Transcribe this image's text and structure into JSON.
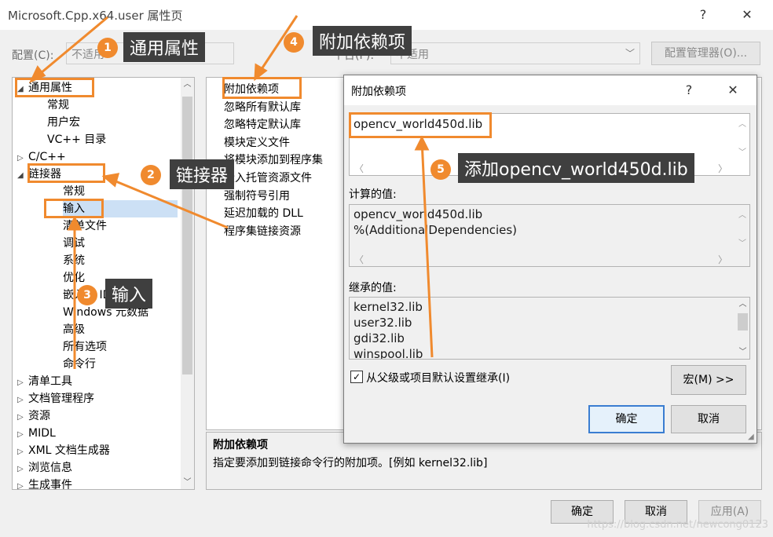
{
  "window": {
    "title": "Microsoft.Cpp.x64.user 属性页",
    "help_label": "?",
    "close_label": "✕"
  },
  "toolbar": {
    "config_label": "配置(C):",
    "config_value": "不适用",
    "platform_label": "平台(P):",
    "platform_value": "不适用",
    "config_manager_label": "配置管理器(O)..."
  },
  "tree": {
    "items": [
      {
        "label": "通用属性",
        "arrow": "◢"
      },
      {
        "label": "常规"
      },
      {
        "label": "用户宏"
      },
      {
        "label": "VC++ 目录"
      },
      {
        "label": "C/C++",
        "arrow": "▷"
      },
      {
        "label": "链接器",
        "arrow": "◢"
      },
      {
        "label": "常规"
      },
      {
        "label": "输入"
      },
      {
        "label": "清单文件"
      },
      {
        "label": "调试"
      },
      {
        "label": "系统"
      },
      {
        "label": "优化"
      },
      {
        "label": "嵌入的 IDL"
      },
      {
        "label": "Windows 元数据"
      },
      {
        "label": "高级"
      },
      {
        "label": "所有选项"
      },
      {
        "label": "命令行"
      },
      {
        "label": "清单工具",
        "arrow": "▷"
      },
      {
        "label": "文档管理程序",
        "arrow": "▷"
      },
      {
        "label": "资源",
        "arrow": "▷"
      },
      {
        "label": "MIDL",
        "arrow": "▷"
      },
      {
        "label": "XML 文档生成器",
        "arrow": "▷"
      },
      {
        "label": "浏览信息",
        "arrow": "▷"
      },
      {
        "label": "生成事件",
        "arrow": "▷"
      }
    ]
  },
  "grid": {
    "rows": [
      "附加依赖项",
      "忽略所有默认库",
      "忽略特定默认库",
      "模块定义文件",
      "将模块添加到程序集",
      "嵌入托管资源文件",
      "强制符号引用",
      "延迟加载的 DLL",
      "程序集链接资源"
    ]
  },
  "description": {
    "title": "附加依赖项",
    "text": "指定要添加到链接命令行的附加项。[例如 kernel32.lib]"
  },
  "footer": {
    "ok_label": "确定",
    "cancel_label": "取消",
    "apply_label": "应用(A)"
  },
  "dialog": {
    "title": "附加依赖项",
    "help_label": "?",
    "close_label": "✕",
    "edit_value": "opencv_world450d.lib",
    "computed_label": "计算的值:",
    "computed_lines": [
      "opencv_world450d.lib",
      "%(AdditionalDependencies)"
    ],
    "inherited_label": "继承的值:",
    "inherited_lines": [
      "kernel32.lib",
      "user32.lib",
      "gdi32.lib",
      "winspool.lib"
    ],
    "inherit_checkbox_label": "从父级或项目默认设置继承(I)",
    "inherit_checked": true,
    "macro_label": "宏(M) >>",
    "ok_label": "确定",
    "cancel_label": "取消"
  },
  "callouts": [
    {
      "number": "1",
      "label": "通用属性"
    },
    {
      "number": "2",
      "label": "链接器"
    },
    {
      "number": "3",
      "label": "输入"
    },
    {
      "number": "4",
      "label": "附加依赖项"
    },
    {
      "number": "5",
      "label": "添加opencv_world450d.lib"
    }
  ],
  "watermark": "https://blog.csdn.net/newcong0123",
  "colors": {
    "accent": "#f08a2e",
    "callout_bg": "#3f3f3f",
    "primary_button_border": "#3a7dd1"
  }
}
